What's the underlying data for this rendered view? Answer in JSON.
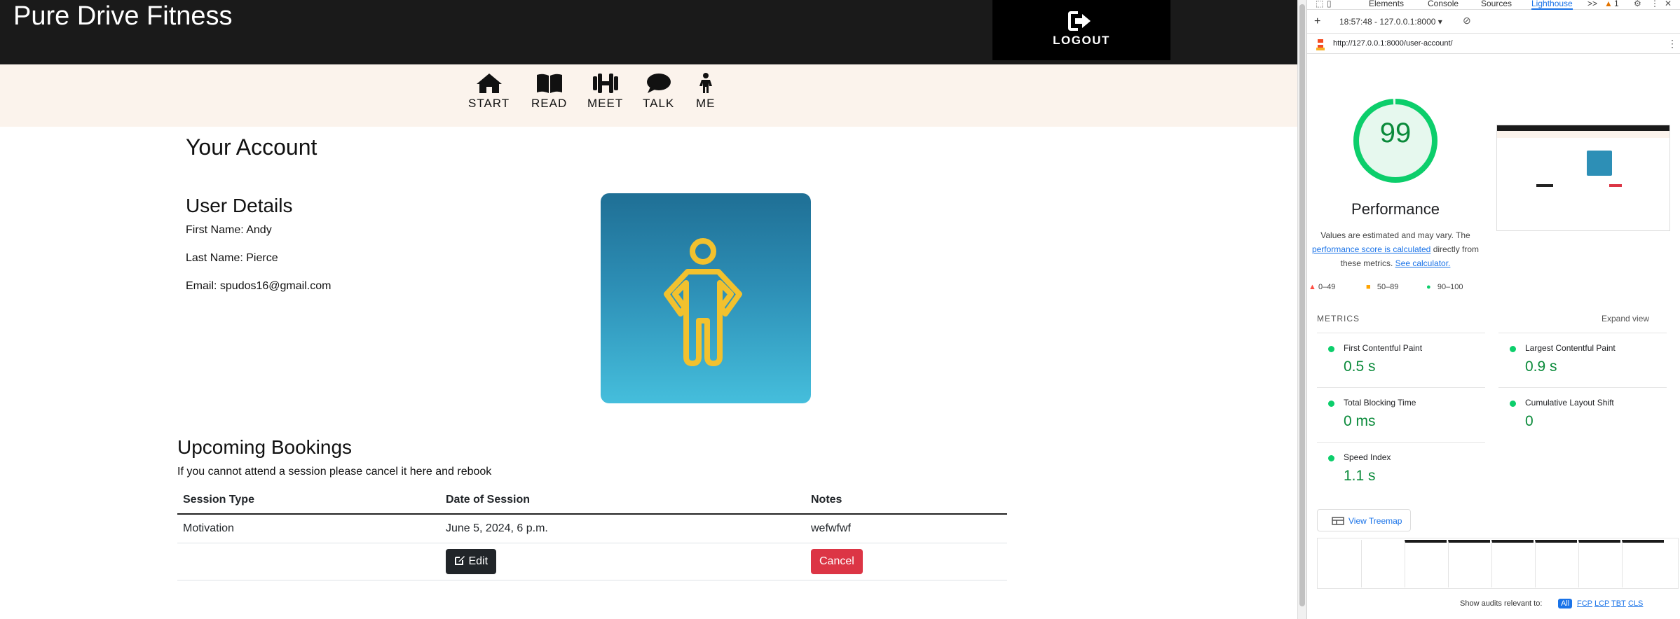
{
  "site": {
    "brand": "Pure Drive Fitness",
    "logout_label": "LOGOUT",
    "nav": [
      {
        "label": "START",
        "icon": "home-icon"
      },
      {
        "label": "READ",
        "icon": "book-icon"
      },
      {
        "label": "MEET",
        "icon": "dumbbell-icon"
      },
      {
        "label": "TALK",
        "icon": "chat-bubble-icon"
      },
      {
        "label": "ME",
        "icon": "person-icon"
      }
    ],
    "page_title": "Your Account",
    "user_details": {
      "heading": "User Details",
      "first_name": "First Name: Andy",
      "last_name": "Last Name: Pierce",
      "email": "Email: spudos16@gmail.com"
    },
    "bookings": {
      "heading": "Upcoming Bookings",
      "note": "If you cannot attend a session please cancel it here and rebook",
      "columns": [
        "Session Type",
        "Date of Session",
        "Notes"
      ],
      "rows": [
        {
          "session_type": "Motivation",
          "date": "June 5, 2024, 6 p.m.",
          "notes": "wefwfwf"
        }
      ],
      "edit_label": "Edit",
      "cancel_label": "Cancel"
    },
    "colors": {
      "header": "#1a1a1a",
      "nav_bg": "#fbf3ec",
      "card_top": "#1f6f95",
      "card_bottom": "#45bedc",
      "figure": "#f2c12e",
      "danger": "#dc3545"
    }
  },
  "devtools": {
    "tabs": [
      "Elements",
      "Console",
      "Sources",
      "Lighthouse"
    ],
    "active_tab": "Lighthouse",
    "more_tabs": ">>",
    "warnings": "1",
    "report_select": "18:57:48 - 127.0.0.1:8000",
    "url": "http://127.0.0.1:8000/user-account/",
    "score": "99",
    "score_fraction": 0.99,
    "category": "Performance",
    "desc_prefix": "Values are estimated and may vary. The",
    "desc_link": "performance score is calculated",
    "desc_mid": "directly from these metrics.",
    "desc_link2": "See calculator.",
    "legend": [
      "0–49",
      "50–89",
      "90–100"
    ],
    "metrics_header": "METRICS",
    "expand_view": "Expand view",
    "metrics": [
      {
        "name": "First Contentful Paint",
        "value": "0.5 s"
      },
      {
        "name": "Largest Contentful Paint",
        "value": "0.9 s"
      },
      {
        "name": "Total Blocking Time",
        "value": "0 ms"
      },
      {
        "name": "Cumulative Layout Shift",
        "value": "0"
      },
      {
        "name": "Speed Index",
        "value": "1.1 s"
      }
    ],
    "treemap_label": "View Treemap",
    "audits_label": "Show audits relevant to:",
    "audit_chips": [
      "All",
      "FCP",
      "LCP",
      "TBT",
      "CLS"
    ],
    "colors": {
      "pass": "#0cce6b",
      "average": "#ffa400",
      "fail": "#ff4e42",
      "link": "#1a73e8"
    }
  }
}
